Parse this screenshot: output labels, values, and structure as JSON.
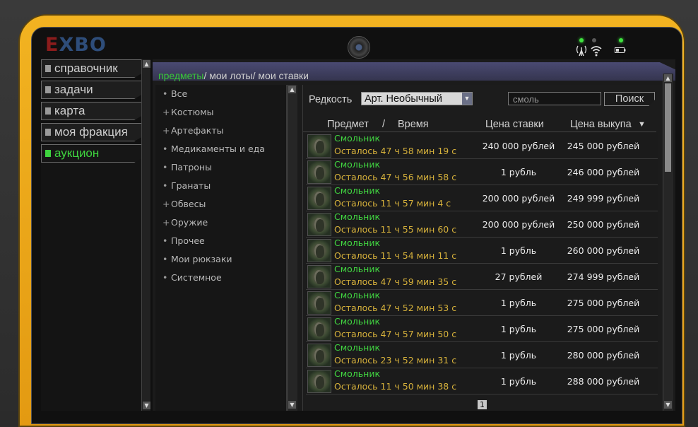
{
  "logo": {
    "part1": "E",
    "part2": "XBO"
  },
  "colors": {
    "accent_green": "#3ed43e",
    "item_name": "#41d641",
    "time_left": "#d6b13b",
    "casing_yellow": "#f2b321",
    "tab_bar": "#4a4a72"
  },
  "nav": {
    "items": [
      {
        "label": "справочник",
        "active": false
      },
      {
        "label": "задачи",
        "active": false
      },
      {
        "label": "карта",
        "active": false
      },
      {
        "label": "моя фракция",
        "active": false
      },
      {
        "label": "аукцион",
        "active": true
      }
    ]
  },
  "tabs": {
    "items": "предметы",
    "my_lots": "мои лоты",
    "my_bids": "мои ставки",
    "separator": "/"
  },
  "categories": [
    {
      "mark": "•",
      "label": "Все"
    },
    {
      "mark": "+",
      "label": "Костюмы"
    },
    {
      "mark": "+",
      "label": "Артефакты"
    },
    {
      "mark": "•",
      "label": "Медикаменты и еда"
    },
    {
      "mark": "•",
      "label": "Патроны"
    },
    {
      "mark": "•",
      "label": "Гранаты"
    },
    {
      "mark": "+",
      "label": "Обвесы"
    },
    {
      "mark": "+",
      "label": "Оружие"
    },
    {
      "mark": "•",
      "label": "Прочее"
    },
    {
      "mark": "•",
      "label": "Мои рюкзаки"
    },
    {
      "mark": "•",
      "label": "Системное"
    }
  ],
  "filter": {
    "rarity_label": "Редкость",
    "rarity_value": "Арт. Необычный",
    "search_value": "смоль",
    "search_button": "Поиск"
  },
  "columns": {
    "item": "Предмет",
    "slash": "/",
    "time": "Время",
    "bid": "Цена ставки",
    "buyout": "Цена выкупа",
    "sort_icon": "▼"
  },
  "lots": [
    {
      "name": "Смольник",
      "time": "Осталось 47 ч 58 мин 19 с",
      "bid": "240 000 рублей",
      "buyout": "245 000 рублей"
    },
    {
      "name": "Смольник",
      "time": "Осталось 47 ч 56 мин 58 с",
      "bid": "1 рубль",
      "buyout": "246 000 рублей"
    },
    {
      "name": "Смольник",
      "time": "Осталось 11 ч 57 мин 4 с",
      "bid": "200 000 рублей",
      "buyout": "249 999 рублей"
    },
    {
      "name": "Смольник",
      "time": "Осталось 11 ч 55 мин 60 с",
      "bid": "200 000 рублей",
      "buyout": "250 000 рублей"
    },
    {
      "name": "Смольник",
      "time": "Осталось 11 ч 54 мин 11 с",
      "bid": "1 рубль",
      "buyout": "260 000 рублей"
    },
    {
      "name": "Смольник",
      "time": "Осталось 47 ч 59 мин 35 с",
      "bid": "27 рублей",
      "buyout": "274 999 рублей"
    },
    {
      "name": "Смольник",
      "time": "Осталось 47 ч 52 мин 53 с",
      "bid": "1 рубль",
      "buyout": "275 000 рублей"
    },
    {
      "name": "Смольник",
      "time": "Осталось 47 ч 57 мин 50 с",
      "bid": "1 рубль",
      "buyout": "275 000 рублей"
    },
    {
      "name": "Смольник",
      "time": "Осталось 23 ч 52 мин 31 с",
      "bid": "1 рубль",
      "buyout": "280 000 рублей"
    },
    {
      "name": "Смольник",
      "time": "Осталось 11 ч 50 мин 38 с",
      "bid": "1 рубль",
      "buyout": "288 000 рублей"
    }
  ],
  "pagination": {
    "current_page": "1"
  }
}
